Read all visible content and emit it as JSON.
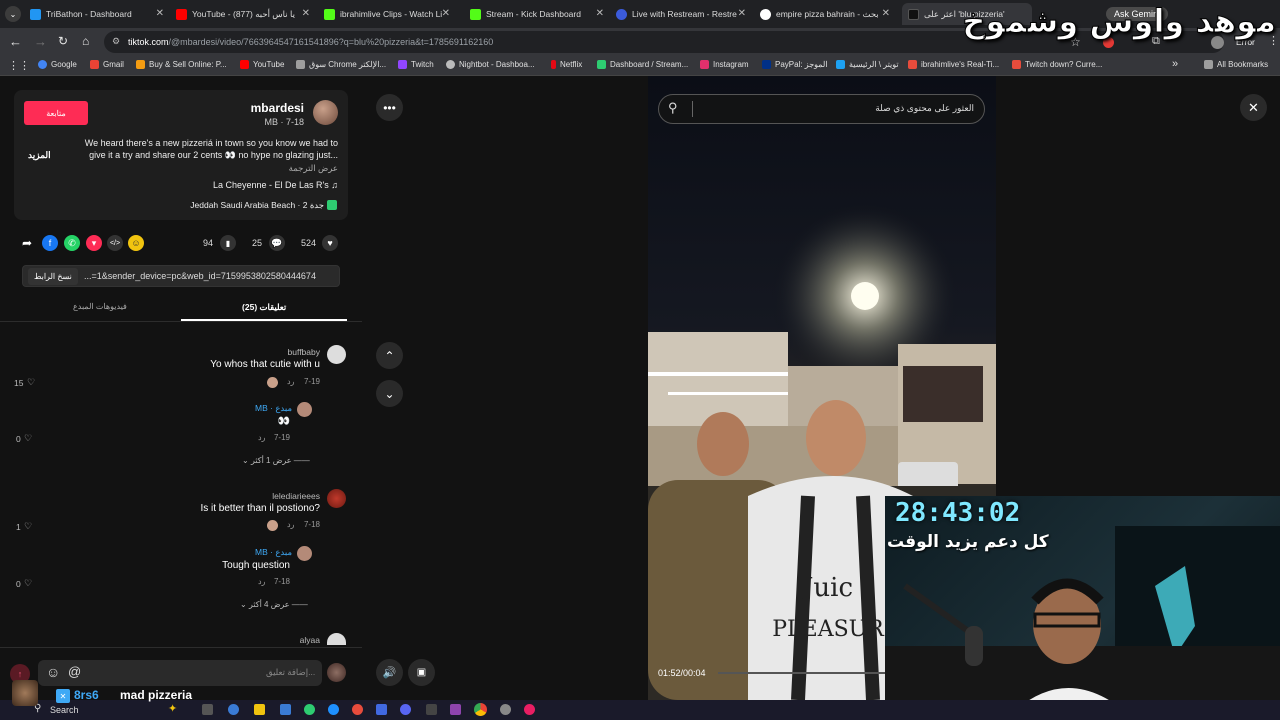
{
  "tabs": [
    {
      "label": "TriBathon - Dashboard",
      "color": "#2196f3"
    },
    {
      "label": "YouTube - يا ناس أحبه (877)",
      "color": "#ff0000"
    },
    {
      "label": "ibrahimlive Clips - Watch Li",
      "color": "#53fc18"
    },
    {
      "label": "Stream - Kick Dashboard",
      "color": "#53fc18"
    },
    {
      "label": "Live with Restream - Restre",
      "color": "#3b5bdb"
    },
    {
      "label": "empire pizza bahrain - بحث",
      "color": "#ffffff"
    },
    {
      "label": "اعثر على 'blu pizzeria'",
      "color": "#111111"
    }
  ],
  "ask_gemini": "Ask Gemini",
  "error_label": "Error",
  "url": {
    "host": "tiktok.com",
    "path": "/@mbardesi/video/7663964547161541896?q=blu%20pizzeria&t=1785691162160"
  },
  "bookmarks": [
    {
      "label": "Google",
      "color": "#4285f4"
    },
    {
      "label": "Gmail",
      "color": "#ea4335"
    },
    {
      "label": "Buy & Sell Online: P...",
      "color": "#f39c12"
    },
    {
      "label": "YouTube",
      "color": "#ff0000"
    },
    {
      "label": "سوق Chrome الإلكتر...",
      "color": "#9e9e9e"
    },
    {
      "label": "Twitch",
      "color": "#9146ff"
    },
    {
      "label": "Nightbot - Dashboa...",
      "color": "#bbbbbb"
    },
    {
      "label": "Netflix",
      "color": "#e50914"
    },
    {
      "label": "Dashboard / Stream...",
      "color": "#2ecc71"
    },
    {
      "label": "Instagram",
      "color": "#e1306c"
    },
    {
      "label": "PayPal: الموجز",
      "color": "#003087"
    },
    {
      "label": "تويتر \\ الرئيسية",
      "color": "#1da1f2"
    },
    {
      "label": "ibrahimlive's Real-Ti...",
      "color": "#e74c3c"
    },
    {
      "label": "Twitch down? Curre...",
      "color": "#e74c3c"
    }
  ],
  "all_bookmarks": "All Bookmarks",
  "overlay_title": "موهد واوس وشموخ",
  "post": {
    "follow_label": "متابعة",
    "username": "mbardesi",
    "meta": "MB · 7-18",
    "caption_line1": "We heard there's a new pizzeriá in town so you know we had to",
    "caption_line2": "give it a try and share our 2 cents 👀 no hype no glazing just...",
    "more_label": "المزيد",
    "translate_label": "عرض الترجمة",
    "music": "La Cheyenne - El De Las R's ♫",
    "location": "Jeddah Saudi Arabia Beach · جدة 2",
    "likes": "524",
    "comments": "25",
    "saves": "94",
    "link_text": "...=1&sender_device=pc&web_id=7159953802580444674",
    "copy_link": "نسخ الرابط",
    "tab_comments": "تعليقات (25)",
    "tab_creator": "فيديوهات المبدع"
  },
  "comments": [
    {
      "user": "buffbaby",
      "text": "Yo whos that cutie with u",
      "date": "7-19",
      "reply": "رد",
      "likes": "15"
    },
    {
      "user": "MB · مبدع",
      "text": "👀",
      "date": "7-19",
      "reply": "رد",
      "likes": "0",
      "more": "عرض 1 أكثر"
    },
    {
      "user": "lelediarieees",
      "text": "Is it better than il postiono?",
      "date": "7-18",
      "reply": "رد",
      "likes": "1"
    },
    {
      "user": "MB · مبدع",
      "text": "Tough question",
      "date": "7-18",
      "reply": "رد",
      "likes": "0",
      "more": "عرض 4 أكثر"
    },
    {
      "user": "alyaa"
    }
  ],
  "comment_placeholder": "إضافة تعليق...",
  "search_placeholder": "العثور على محتوى ذي صلة",
  "video_time": "01:52/00:04",
  "timer": "28:43:02",
  "timer_caption": "كل دعم يزيد الوقت",
  "stream_chat": {
    "user": "8rs6",
    "message": "mad pizzeria"
  },
  "taskbar_search": "Search"
}
